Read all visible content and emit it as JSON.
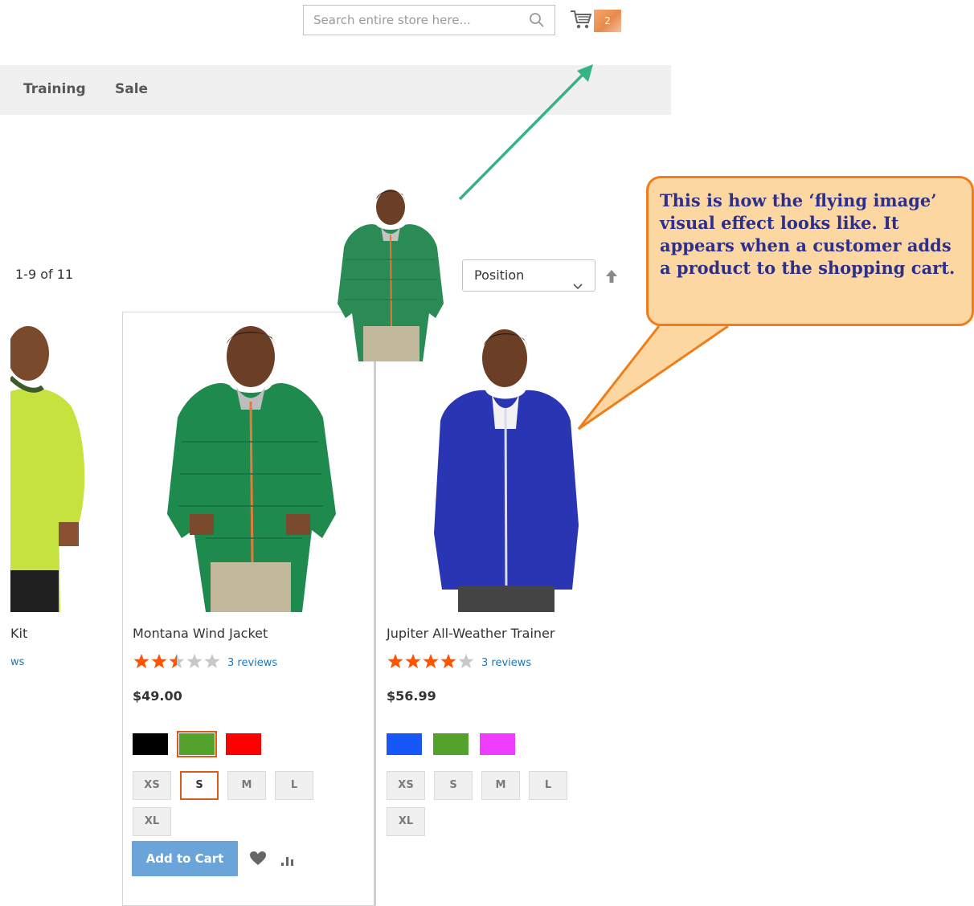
{
  "header": {
    "search_placeholder": "Search entire store here...",
    "cart_count": "2",
    "icons": [
      "search-icon",
      "cart-icon"
    ]
  },
  "nav": {
    "items": [
      "Training",
      "Sale"
    ]
  },
  "toolbar": {
    "amount": "1-9 of 11",
    "sort_selected": "Position",
    "icons": [
      "chevron-down-icon",
      "sort-arrow-up-icon"
    ]
  },
  "products": [
    {
      "name_partial": "Kit",
      "reviews_partial": "ws"
    },
    {
      "name": "Montana Wind Jacket",
      "rating_stars": 2.5,
      "reviews": "3 reviews",
      "price": "$49.00",
      "colors": [
        "#000000",
        "#52a22b",
        "#ff0000"
      ],
      "selected_color": 1,
      "sizes": [
        "XS",
        "S",
        "M",
        "L",
        "XL"
      ],
      "selected_size": 1,
      "add_to_cart": "Add to Cart"
    },
    {
      "name": "Jupiter All-Weather Trainer",
      "rating_stars": 4,
      "reviews": "3 reviews",
      "price": "$56.99",
      "colors": [
        "#1857f7",
        "#52a22b",
        "#ef3dff"
      ],
      "sizes": [
        "XS",
        "S",
        "M",
        "L",
        "XL"
      ]
    }
  ],
  "callout": {
    "text": "This is how the ‘flying image’ visual effect looks like. It appears when a customer adds a product to the shopping cart."
  },
  "colors": {
    "accent_orange": "#ef7d1b",
    "star_orange": "#ff5501",
    "link_blue": "#1979c3",
    "arrow_green": "#34b383"
  }
}
